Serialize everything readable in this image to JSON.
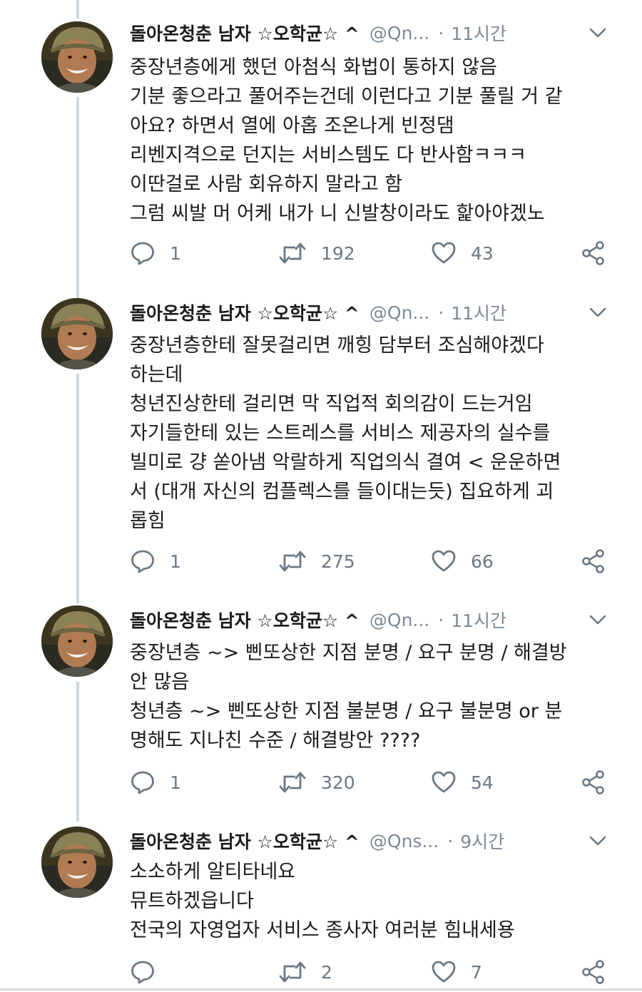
{
  "tweets": [
    {
      "display_name": "돌아온청춘 남자 ☆오학균☆ ^",
      "handle": "@Qn...",
      "separator": "·",
      "time": "11시간",
      "lines": [
        "중장년층에게 했던 아첨식 화법이 통하지 않음",
        "기분 좋으라고 풀어주는건데 이런다고 기분 풀릴 거 같",
        "아요? 하면서 열에 아홉 조온나게 빈정댐",
        "리벤지격으로 던지는 서비스템도 다 반사함ㅋㅋㅋ",
        "이딴걸로 사람 회유하지 말라고 함",
        "그럼 씨발 머 어케 내가 니 신발창이라도 핥아야겠노"
      ],
      "replies": "1",
      "retweets": "192",
      "likes": "43"
    },
    {
      "display_name": "돌아온청춘 남자 ☆오학균☆ ^",
      "handle": "@Qn...",
      "separator": "·",
      "time": "11시간",
      "lines": [
        "중장년층한테 잘못걸리면 깨힝 담부터 조심해야겠다",
        "하는데",
        "청년진상한테 걸리면 막 직업적 회의감이 드는거임",
        "자기들한테 있는 스트레스를 서비스 제공자의 실수를",
        "빌미로 걍 쏟아냄 악랄하게 직업의식 결여 < 운운하면",
        "서 (대개 자신의 컴플렉스를 들이대는듯) 집요하게 괴",
        "롭힘"
      ],
      "replies": "1",
      "retweets": "275",
      "likes": "66"
    },
    {
      "display_name": "돌아온청춘 남자 ☆오학균☆ ^",
      "handle": "@Qn...",
      "separator": "·",
      "time": "11시간",
      "lines": [
        "중장년층 ~> 삔또상한 지점 분명 / 요구 분명 / 해결방",
        "안 많음",
        "청년층 ~> 삔또상한 지점 불분명 / 요구 불분명 or 분",
        "명해도 지나친 수준 / 해결방안 ????"
      ],
      "replies": "1",
      "retweets": "320",
      "likes": "54"
    },
    {
      "display_name": "돌아온청춘 남자 ☆오학균☆ ^",
      "handle": "@Qns...",
      "separator": "·",
      "time": "9시간",
      "lines": [
        "소소하게 알티타네요",
        "뮤트하겠읍니다",
        "전국의 자영업자 서비스 종사자 여러분 힘내세용"
      ],
      "replies": "",
      "retweets": "2",
      "likes": "7"
    }
  ],
  "icons": {
    "reply": "reply-icon",
    "retweet": "retweet-icon",
    "like": "like-icon",
    "share": "share-icon",
    "caret": "chevron-down-icon"
  },
  "colors": {
    "text": "#1c1c1c",
    "muted": "#6b7885",
    "thread_line": "#cfd8de"
  }
}
